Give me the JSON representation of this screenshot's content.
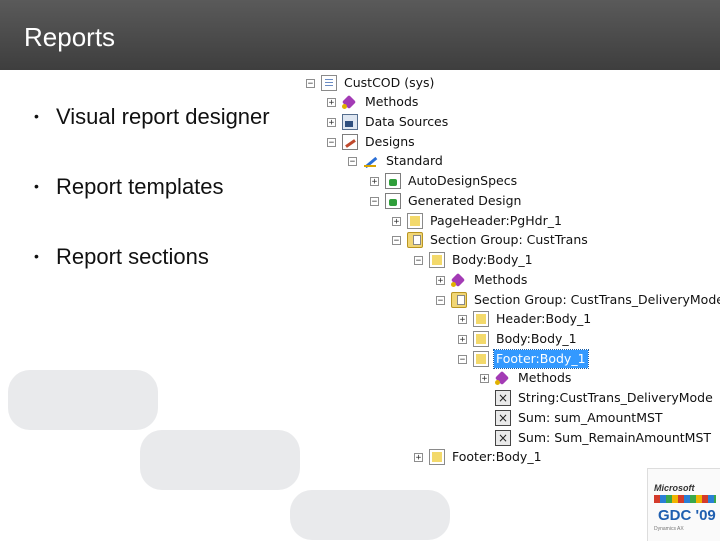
{
  "slide": {
    "title": "Reports"
  },
  "bullets": [
    {
      "text": "Visual report designer"
    },
    {
      "text": "Report templates"
    },
    {
      "text": "Report sections"
    }
  ],
  "tree": [
    {
      "label": "CustCOD (sys)",
      "icon": "report-icon",
      "toggle": "−"
    },
    {
      "label": "Methods",
      "icon": "methods-icon",
      "toggle": "+"
    },
    {
      "label": "Data Sources",
      "icon": "data-sources-icon",
      "toggle": "+"
    },
    {
      "label": "Designs",
      "icon": "designs-icon",
      "toggle": "−"
    },
    {
      "label": "Standard",
      "icon": "design-icon",
      "toggle": "−"
    },
    {
      "label": "AutoDesignSpecs",
      "icon": "auto-design-icon",
      "toggle": "+"
    },
    {
      "label": "Generated Design",
      "icon": "generated-design-icon",
      "toggle": "−"
    },
    {
      "label": "PageHeader:PgHdr_1",
      "icon": "section-icon",
      "toggle": "+"
    },
    {
      "label": "Section Group: CustTrans",
      "icon": "section-group-icon",
      "toggle": "−"
    },
    {
      "label": "Body:Body_1",
      "icon": "section-icon",
      "toggle": "−"
    },
    {
      "label": "Methods",
      "icon": "methods-icon",
      "toggle": "+"
    },
    {
      "label": "Section Group: CustTrans_DeliveryMode",
      "icon": "section-group-icon",
      "toggle": "−"
    },
    {
      "label": "Header:Body_1",
      "icon": "section-icon",
      "toggle": "+"
    },
    {
      "label": "Body:Body_1",
      "icon": "section-icon",
      "toggle": "+"
    },
    {
      "label": "Footer:Body_1",
      "icon": "section-icon",
      "toggle": "−",
      "selected": true
    },
    {
      "label": "Methods",
      "icon": "methods-icon",
      "toggle": "+"
    },
    {
      "label": "String:CustTrans_DeliveryMode",
      "icon": "field-icon",
      "toggle": ""
    },
    {
      "label": "Sum: sum_AmountMST",
      "icon": "field-icon",
      "toggle": ""
    },
    {
      "label": "Sum: Sum_RemainAmountMST",
      "icon": "field-icon",
      "toggle": ""
    },
    {
      "label": "Footer:Body_1",
      "icon": "section-icon",
      "toggle": "+"
    }
  ],
  "logo": {
    "brand": "Microsoft",
    "event": "GDC '09",
    "tagline": "Dynamics AX"
  }
}
